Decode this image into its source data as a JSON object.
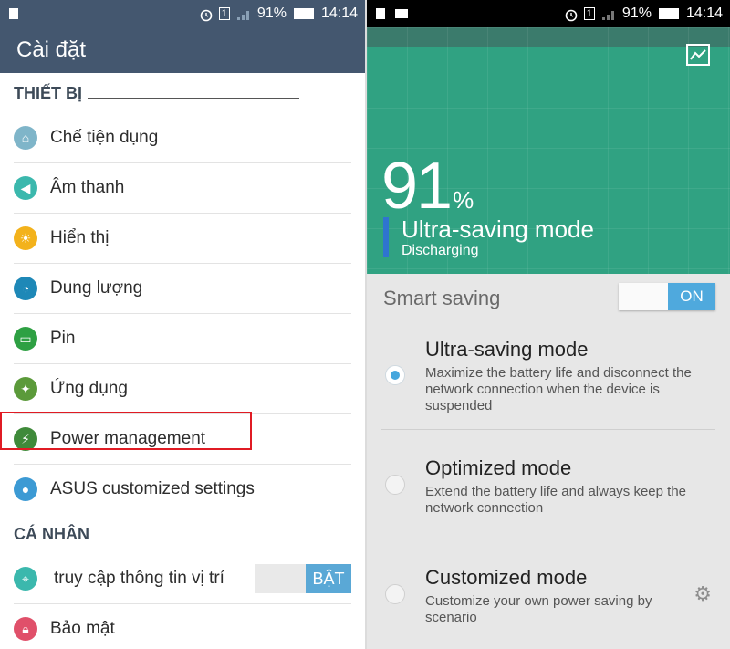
{
  "left": {
    "status": {
      "battery": "91%",
      "time": "14:14",
      "sim": "1"
    },
    "title": "Cài đặt",
    "section_device": "THIẾT BỊ",
    "items": [
      {
        "label": "Chế tiện dụng",
        "color": "#7fb5c9"
      },
      {
        "label": "Âm thanh",
        "color": "#3bb8ad"
      },
      {
        "label": "Hiển thị",
        "color": "#f3b21b"
      },
      {
        "label": "Dung lượng",
        "color": "#1e88b7"
      },
      {
        "label": "Pin",
        "color": "#2ea043"
      },
      {
        "label": "Ứng dụng",
        "color": "#5b9a3a"
      },
      {
        "label": "Power management",
        "color": "#3f8a3a"
      },
      {
        "label": "ASUS customized settings",
        "color": "#3c9ad4"
      }
    ],
    "section_personal": "CÁ NHÂN",
    "personal_items": [
      {
        "label": "truy cập thông tin vị trí",
        "color": "#3bb8ad",
        "toggle": "BẬT"
      },
      {
        "label": "Bảo mật",
        "color": "#e0506a"
      }
    ],
    "highlight_color": "#e01b24"
  },
  "right": {
    "status": {
      "battery": "91%",
      "time": "14:14",
      "sim": "1"
    },
    "battery_pct": "91",
    "battery_unit": "%",
    "current_mode": "Ultra-saving mode",
    "current_state": "Discharging",
    "smart_saving_label": "Smart saving",
    "smart_saving_toggle": "ON",
    "options": [
      {
        "title": "Ultra-saving mode",
        "desc": "Maximize the battery life and disconnect the network connection when the device is suspended",
        "selected": true
      },
      {
        "title": "Optimized mode",
        "desc": "Extend the battery life and always keep the network connection",
        "selected": false
      },
      {
        "title": "Customized mode",
        "desc": "Customize your own power saving by scenario",
        "selected": false
      }
    ],
    "accent": "#30a282"
  }
}
